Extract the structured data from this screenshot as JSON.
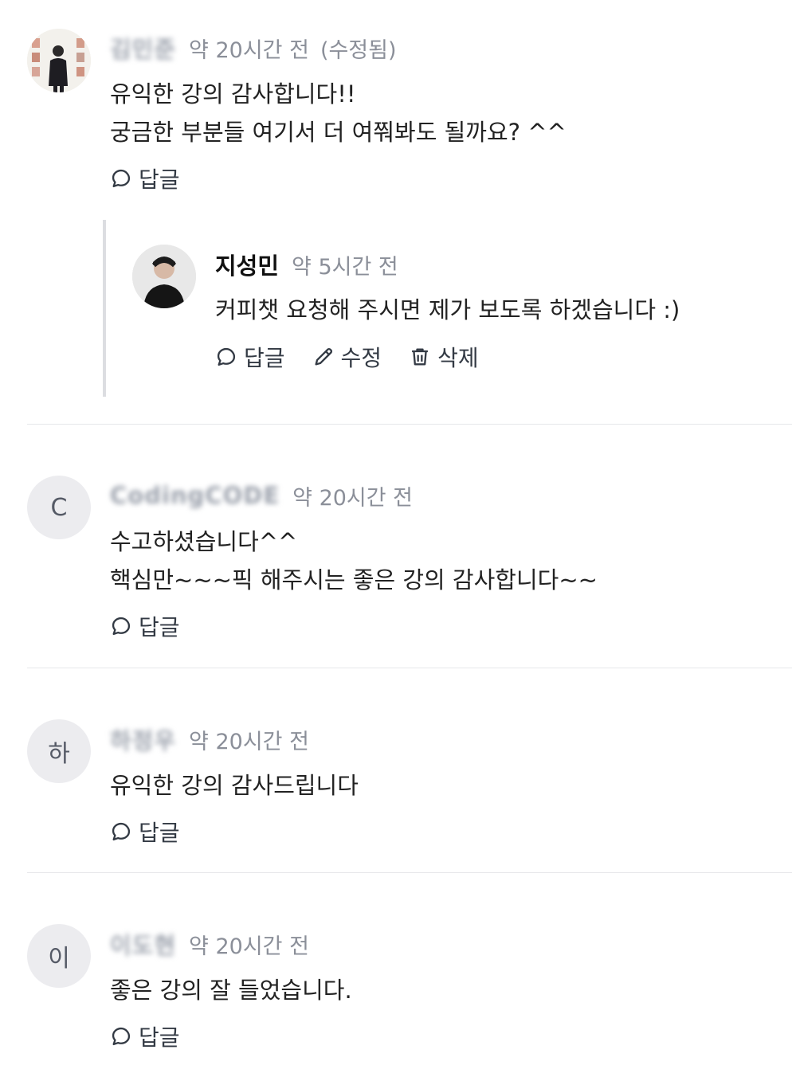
{
  "comments": [
    {
      "author": "김민준",
      "time": "약 20시간 전",
      "edited": "(수정됨)",
      "lines": [
        "유익한 강의 감사합니다!!",
        "궁금한 부분들 여기서 더 여쭤봐도 될까요? ^^"
      ],
      "reply_label": "답글"
    },
    {
      "author": "CodingCODE",
      "avatar_letter": "C",
      "time": "약 20시간 전",
      "lines": [
        "수고하셨습니다^^",
        "핵심만~~~픽 해주시는 좋은 강의 감사합니다~~"
      ],
      "reply_label": "답글"
    },
    {
      "author": "하정우",
      "avatar_letter": "하",
      "time": "약 20시간 전",
      "lines": [
        "유익한 강의 감사드립니다"
      ],
      "reply_label": "답글"
    },
    {
      "author": "이도현",
      "avatar_letter": "이",
      "time": "약 20시간 전",
      "lines": [
        "좋은 강의 잘 들었습니다."
      ],
      "reply_label": "답글"
    }
  ],
  "reply": {
    "author": "지성민",
    "time": "약 5시간 전",
    "text": "커피챗 요청해 주시면 제가 보도록 하겠습니다 :)",
    "reply_label": "답글",
    "edit_label": "수정",
    "delete_label": "삭제"
  },
  "icons": {
    "reply": "speech-bubble-icon",
    "edit": "pencil-icon",
    "delete": "trash-icon"
  },
  "colors": {
    "text": "#222222",
    "muted": "#8b8f99",
    "avatar_bg": "#ececef",
    "divider": "#e6e7ea"
  }
}
